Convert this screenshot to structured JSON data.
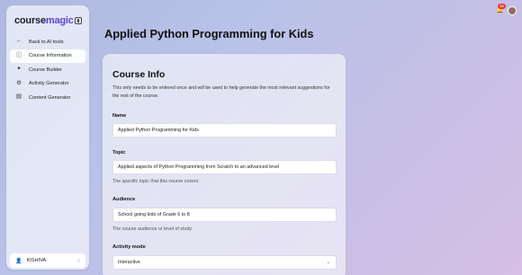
{
  "app": {
    "logo_prefix": "course",
    "logo_accent": "magic",
    "notification_count": "16"
  },
  "sidebar": {
    "items": [
      {
        "label": "Back to AI tools",
        "icon": "arrow-left-icon"
      },
      {
        "label": "Course Information",
        "icon": "info-icon"
      },
      {
        "label": "Course Builder",
        "icon": "magic-wand-icon"
      },
      {
        "label": "Activity Generator",
        "icon": "activity-icon"
      },
      {
        "label": "Content Generator",
        "icon": "document-icon"
      }
    ],
    "active_index": 1,
    "user": "KISHIVA"
  },
  "main": {
    "title": "Applied Python Programming for Kids"
  },
  "course_info": {
    "title": "Course Info",
    "description": "This only needs to be entered once and will be used to help generate the most relevant suggestions for the rest of the course.",
    "name_label": "Name",
    "name_value": "Applied Python Programming for Kids",
    "topic_label": "Topic",
    "topic_value": "Applied aspects of Python Programming from Scratch to an advanced level",
    "topic_help": "The specific topic that this course covers",
    "audience_label": "Audience",
    "audience_value": "School going kids of Grade 6 to 8",
    "audience_help": "The course audience or level of study",
    "activity_label": "Activity mode",
    "activity_value": "Interactive"
  },
  "colors": {
    "accent": "#5b43d6",
    "badge": "#e53935"
  }
}
